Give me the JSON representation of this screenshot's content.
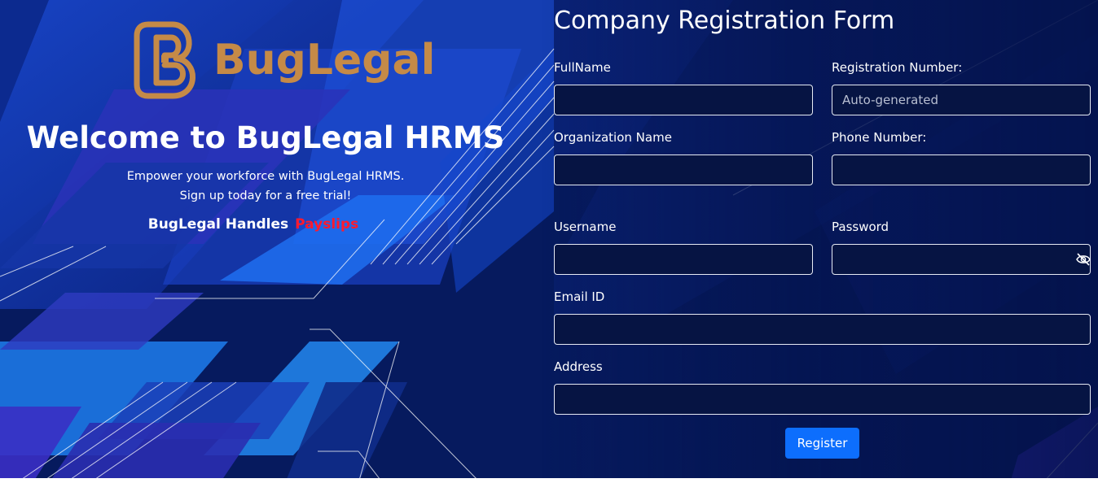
{
  "brand": {
    "name": "BugLegal",
    "logo_icon": "buglegal-logo-icon",
    "color": "#c58a47"
  },
  "hero": {
    "title": "Welcome to BugLegal HRMS",
    "subtitle_line1": "Empower your workforce with BugLegal HRMS.",
    "subtitle_line2": "Sign up today for a free trial!",
    "handles_prefix": "BugLegal Handles",
    "handles_word": "Payslips",
    "accent_color": "#ff1a2e"
  },
  "form": {
    "title": "Company Registration Form",
    "fields": {
      "fullname": {
        "label": "FullName",
        "value": "",
        "placeholder": ""
      },
      "registration_number": {
        "label": "Registration Number:",
        "value": "",
        "placeholder": "Auto-generated"
      },
      "organization_name": {
        "label": "Organization Name",
        "value": "",
        "placeholder": ""
      },
      "phone_number": {
        "label": "Phone Number:",
        "value": "",
        "placeholder": ""
      },
      "username": {
        "label": "Username",
        "value": "",
        "placeholder": ""
      },
      "password": {
        "label": "Password",
        "value": "",
        "placeholder": "",
        "toggle_icon": "eye-slash-icon"
      },
      "email": {
        "label": "Email ID",
        "value": "",
        "placeholder": ""
      },
      "address": {
        "label": "Address",
        "value": "",
        "placeholder": ""
      }
    },
    "register_label": "Register",
    "button_color": "#0d6efd"
  }
}
